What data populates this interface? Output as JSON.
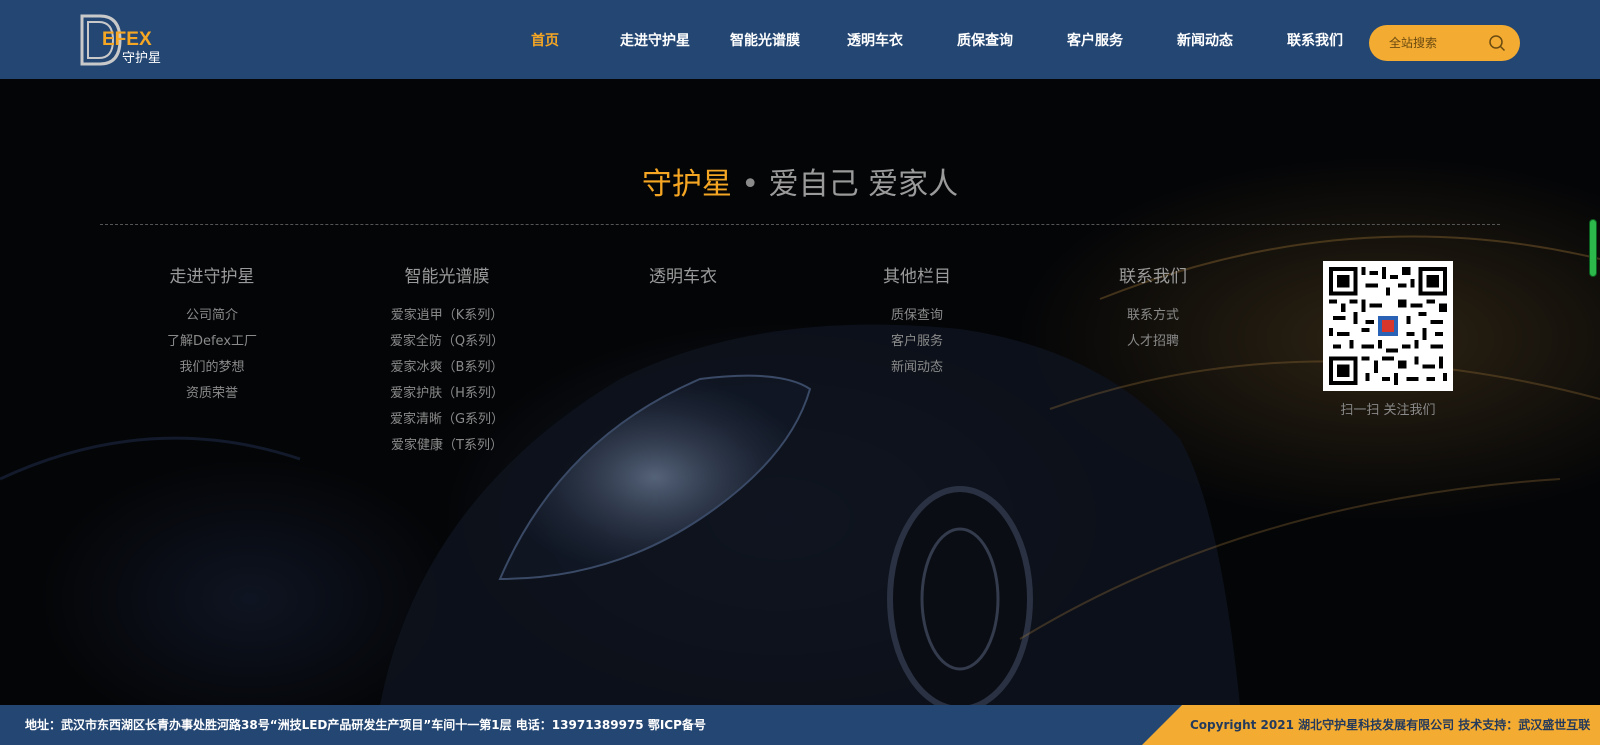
{
  "header": {
    "logo": {
      "letters": "DEFEX",
      "brand": "守护星"
    },
    "nav": [
      "首页",
      "走进守护星",
      "智能光谱膜",
      "透明车衣",
      "质保查询",
      "客户服务",
      "新闻动态",
      "联系我们"
    ],
    "active_nav": "首页",
    "search": {
      "placeholder": "全站搜索",
      "icon": "search-icon"
    }
  },
  "hero": {
    "slogan": {
      "brand": "守护星",
      "dot": "•",
      "rest": "爱自己 爱家人"
    },
    "columns": [
      {
        "title": "走进守护星",
        "links": [
          "公司简介",
          "了解Defex工厂",
          "我们的梦想",
          "资质荣誉"
        ]
      },
      {
        "title": "智能光谱膜",
        "links": [
          "爱家逍甲（K系列）",
          "爱家全防（Q系列）",
          "爱家冰爽（B系列）",
          "爱家护肤（H系列）",
          "爱家清晰（G系列）",
          "爱家健康（T系列）"
        ]
      },
      {
        "title": "透明车衣",
        "links": []
      },
      {
        "title": "其他栏目",
        "links": [
          "质保查询",
          "客户服务",
          "新闻动态"
        ]
      },
      {
        "title": "联系我们",
        "links": [
          "联系方式",
          "人才招聘"
        ]
      }
    ],
    "qr_caption": "扫一扫 关注我们"
  },
  "footer": {
    "address": "地址：武汉市东西湖区长青办事处胜河路38号“洲技LED产品研发生产项目”车间十一第1层 电话：13971389975 鄂ICP备号",
    "copyright": "Copyright 2021 湖北守护星科技发展有限公司 技术支持：武汉盛世互联"
  },
  "colors": {
    "header_bg": "#244673",
    "accent": "#f5a623",
    "search_bg": "#f3ac31",
    "background": "#000000"
  }
}
